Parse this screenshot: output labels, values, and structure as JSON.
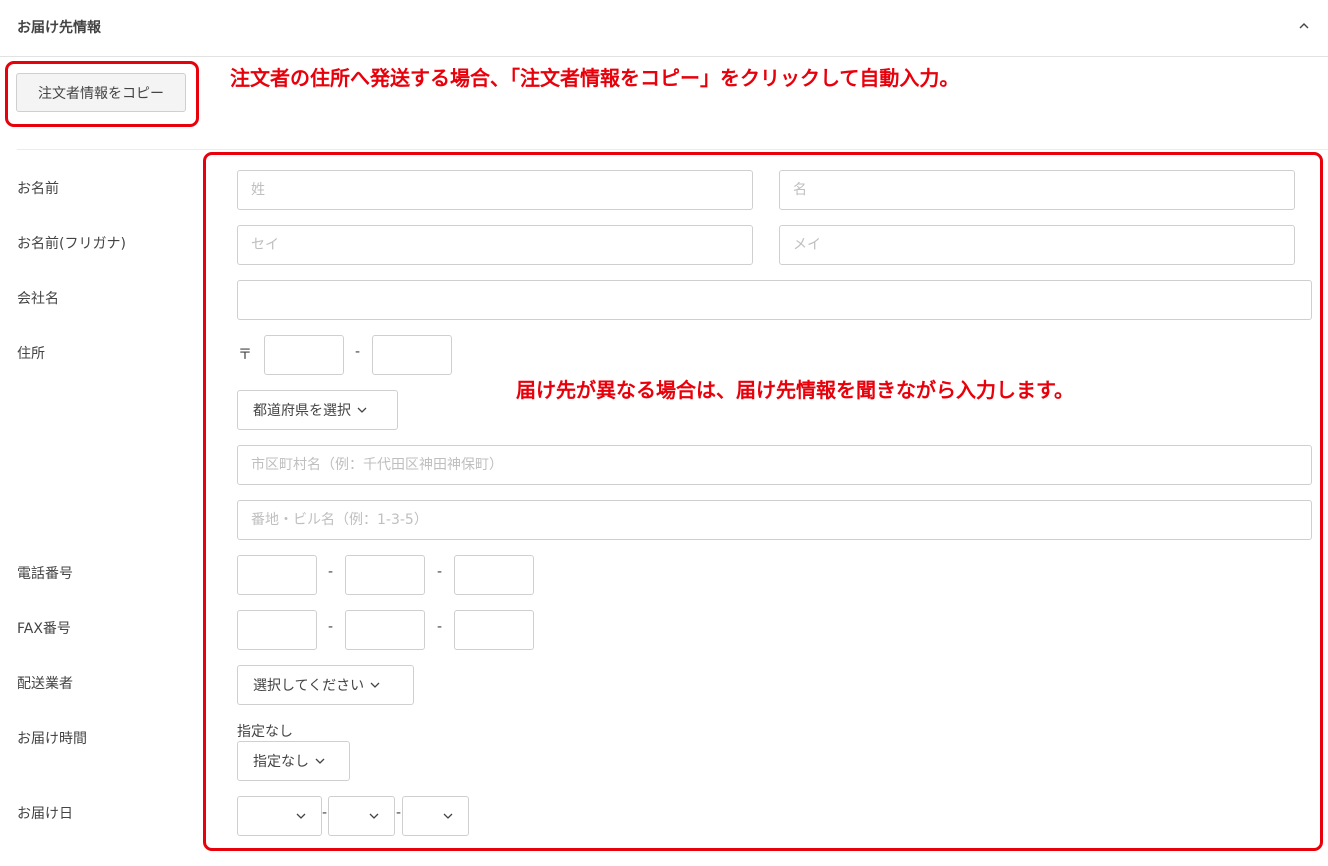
{
  "section": {
    "title": "お届け先情報"
  },
  "copy_button": {
    "label": "注文者情報をコピー"
  },
  "annotations": {
    "copy_note": "注文者の住所へ発送する場合、「注文者情報をコピー」をクリックして自動入力。",
    "different_note": "届け先が異なる場合は、届け先情報を聞きながら入力します。"
  },
  "labels": {
    "name": "お名前",
    "name_kana": "お名前(フリガナ)",
    "company": "会社名",
    "address": "住所",
    "phone": "電話番号",
    "fax": "FAX番号",
    "carrier": "配送業者",
    "delivery_time": "お届け時間",
    "delivery_date": "お届け日"
  },
  "fields": {
    "last_name": {
      "value": "",
      "placeholder": "姓"
    },
    "first_name": {
      "value": "",
      "placeholder": "名"
    },
    "last_name_kana": {
      "value": "",
      "placeholder": "セイ"
    },
    "first_name_kana": {
      "value": "",
      "placeholder": "メイ"
    },
    "company": {
      "value": "",
      "placeholder": ""
    },
    "zip_mark": "〒",
    "zip1": {
      "value": ""
    },
    "zip2": {
      "value": ""
    },
    "prefecture": {
      "selected": "都道府県を選択"
    },
    "city": {
      "value": "",
      "placeholder": "市区町村名（例：千代田区神田神保町）"
    },
    "street": {
      "value": "",
      "placeholder": "番地・ビル名（例：1-3-5）"
    },
    "phone": [
      "",
      "",
      ""
    ],
    "fax": [
      "",
      "",
      ""
    ],
    "carrier": {
      "selected": "選択してください"
    },
    "delivery_time": {
      "caption": "指定なし",
      "selected": "指定なし"
    },
    "delivery_date": {
      "year": "",
      "month": "",
      "day": ""
    }
  },
  "separators": {
    "dash": "-"
  },
  "icons": {
    "collapse": "chevron-up-icon",
    "dropdown": "chevron-down-icon"
  },
  "colors": {
    "annotation_red": "#e8000b",
    "border": "#cfcfcf",
    "placeholder": "#bfbfbf",
    "text": "#444444"
  }
}
